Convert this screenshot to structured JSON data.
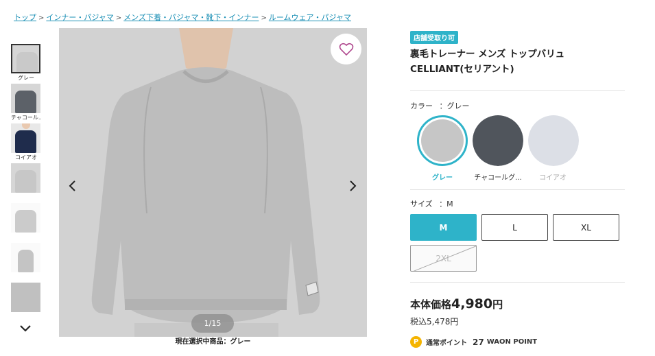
{
  "breadcrumb": {
    "items": [
      "トップ",
      "インナー・パジャマ",
      "メンズ下着・パジャマ・靴下・インナー",
      "ルームウェア・パジャマ"
    ],
    "separator": ">"
  },
  "thumbnails": {
    "labels": [
      "グレー",
      "チャコール...",
      "コイアオ",
      "",
      "",
      "",
      ""
    ],
    "colors": [
      "#c9c9c9",
      "#5c6168",
      "#1f2c4c",
      "#c7c7c7",
      "#cbcbcb",
      "#c4c4c4",
      "#c0c0c0"
    ]
  },
  "gallery": {
    "counter": "1/15",
    "current_item": "現在選択中商品：グレー"
  },
  "product": {
    "badge": "店舗受取り可",
    "title": "裏毛トレーナー メンズ トップバリュ CELLIANT(セリアント)"
  },
  "color_section": {
    "label": "カラー",
    "selected": "：グレー",
    "options": [
      {
        "name": "グレー",
        "swatch": "#c6c6c6",
        "selected": true
      },
      {
        "name": "チャコールグ...",
        "swatch": "#50555c",
        "selected": false
      },
      {
        "name": "コイアオ",
        "swatch": "#dcdfe6",
        "selected": false
      }
    ]
  },
  "size_section": {
    "label": "サイズ",
    "selected": "：M",
    "options": [
      "M",
      "L",
      "XL",
      "2XL"
    ]
  },
  "price": {
    "label": "本体価格",
    "value": "4,980",
    "unit": "円",
    "tax_included": "税込5,478円"
  },
  "points": {
    "icon_letter": "P",
    "label": "通常ポイント",
    "amount": "27",
    "unit": "WAON POINT"
  },
  "accent_color": "#2eb3c9"
}
